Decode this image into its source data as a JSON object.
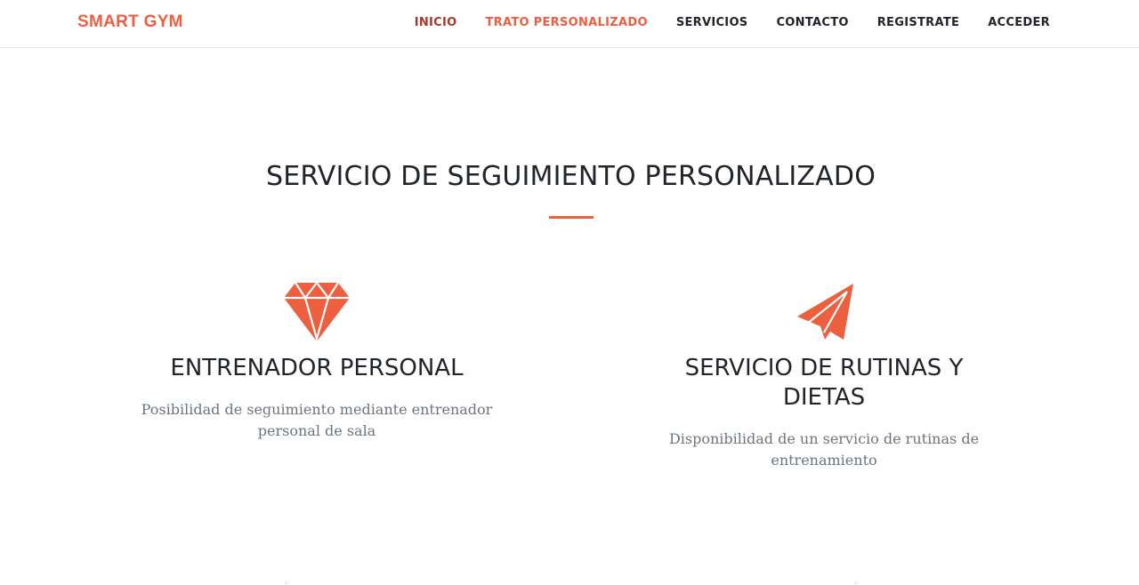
{
  "navbar": {
    "brand": "SMART GYM",
    "links": [
      {
        "label": "INICIO"
      },
      {
        "label": "TRATO PERSONALIZADO"
      },
      {
        "label": "SERVICIOS"
      },
      {
        "label": "CONTACTO"
      },
      {
        "label": "REGISTRATE"
      },
      {
        "label": "ACCEDER"
      }
    ]
  },
  "section": {
    "title": "SERVICIO DE SEGUIMIENTO PERSONALIZADO",
    "features": [
      {
        "icon": "gem-icon",
        "heading": "ENTRENADOR PERSONAL",
        "text": "Posibilidad de seguimiento mediante entrenador personal de sala"
      },
      {
        "icon": "paper-plane-icon",
        "heading": "SERVICIO DE RUTINAS Y DIETAS",
        "text": "Disponibilidad de un servicio de rutinas de entrenamiento"
      }
    ]
  },
  "colors": {
    "accent": "#ec5f3f",
    "text_dark": "#212529",
    "text_muted": "#6c757d",
    "nav_inicio": "#a43b2a"
  }
}
